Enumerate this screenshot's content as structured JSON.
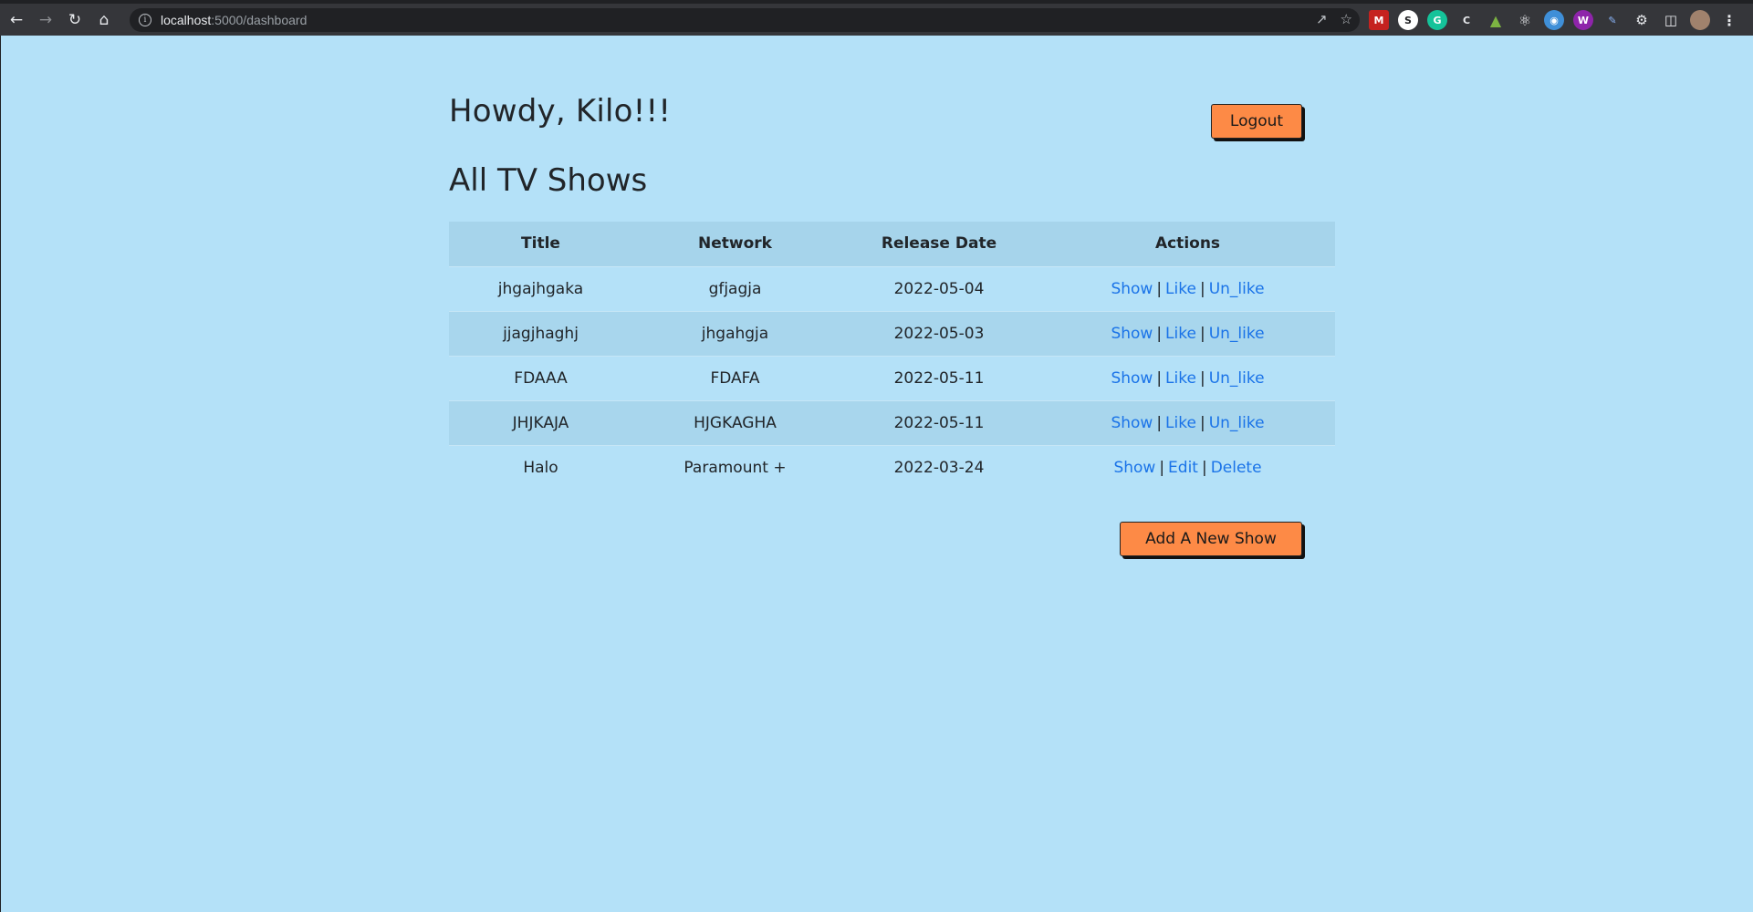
{
  "browser": {
    "url_host": "localhost",
    "url_path": ":5000/dashboard",
    "icons": [
      "back-icon",
      "forward-icon",
      "reload-icon",
      "home-icon",
      "info-icon",
      "share-icon",
      "star-icon",
      "extensions-icon",
      "sidepanel-icon",
      "avatar",
      "menu-icon"
    ]
  },
  "header": {
    "greeting": "Howdy, Kilo!!!",
    "logout_label": "Logout"
  },
  "main": {
    "title": "All TV Shows",
    "columns": [
      "Title",
      "Network",
      "Release Date",
      "Actions"
    ],
    "rows": [
      {
        "title": "jhgajhgaka",
        "network": "gfjagja",
        "release_date": "2022-05-04",
        "actions": [
          "Show",
          "Like",
          "Un_like"
        ]
      },
      {
        "title": "jjagjhaghj",
        "network": "jhgahgja",
        "release_date": "2022-05-03",
        "actions": [
          "Show",
          "Like",
          "Un_like"
        ]
      },
      {
        "title": "FDAAA",
        "network": "FDAFA",
        "release_date": "2022-05-11",
        "actions": [
          "Show",
          "Like",
          "Un_like"
        ]
      },
      {
        "title": "JHJKAJA",
        "network": "HJGKAGHA",
        "release_date": "2022-05-11",
        "actions": [
          "Show",
          "Like",
          "Un_like"
        ]
      },
      {
        "title": "Halo",
        "network": "Paramount +",
        "release_date": "2022-03-24",
        "actions": [
          "Show",
          "Edit",
          "Delete"
        ]
      }
    ],
    "add_label": "Add A New Show"
  },
  "colors": {
    "page_bg": "#b4e1f8",
    "button": "#fd8a46",
    "link": "#1a73e8"
  }
}
